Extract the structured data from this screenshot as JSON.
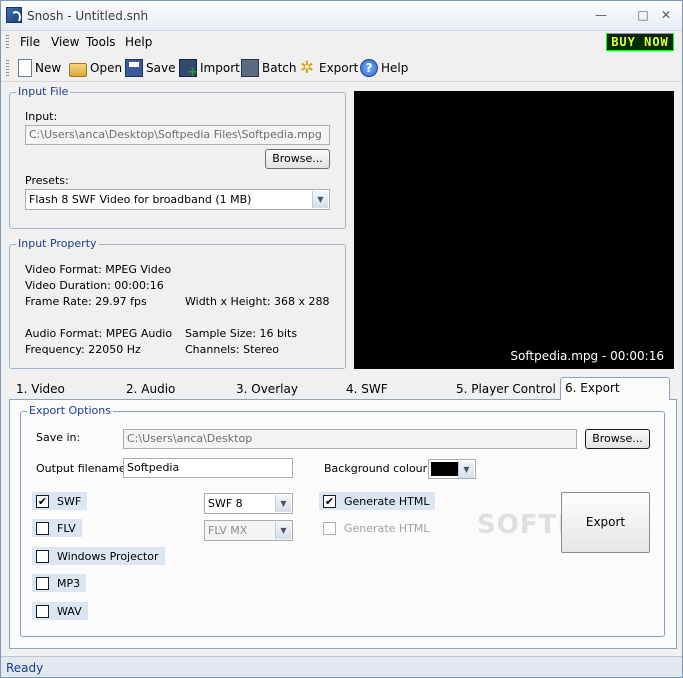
{
  "window": {
    "title": "Snosh - Untitled.snh",
    "minimize": "—",
    "maximize": "□",
    "close": "✕"
  },
  "menu": {
    "items": [
      "File",
      "View",
      "Tools",
      "Help"
    ],
    "buy_now": "BUY NOW"
  },
  "toolbar": {
    "new": "New",
    "open": "Open",
    "save": "Save",
    "import": "Import",
    "batch": "Batch",
    "export": "Export",
    "help": "Help"
  },
  "input_file": {
    "group_label": "Input File",
    "input_label": "Input:",
    "input_value": "C:\\Users\\anca\\Desktop\\Softpedia Files\\Softpedia.mpg",
    "browse": "Browse...",
    "presets_label": "Presets:",
    "preset_value": "Flash 8 SWF Video for broadband (1 MB)"
  },
  "input_property": {
    "group_label": "Input Property",
    "video_format": "Video Format: MPEG Video",
    "video_duration": "Video Duration: 00:00:16",
    "frame_rate": "Frame Rate: 29.97 fps",
    "dimensions": "Width x Height: 368 x 288",
    "audio_format": "Audio Format: MPEG Audio",
    "sample_size": "Sample Size: 16 bits",
    "frequency": "Frequency: 22050 Hz",
    "channels": "Channels: Stereo"
  },
  "preview": {
    "caption": "Softpedia.mpg - 00:00:16"
  },
  "tabs": [
    "1. Video",
    "2. Audio",
    "3. Overlay",
    "4. SWF",
    "5. Player Control",
    "6. Export"
  ],
  "export_options": {
    "group_label": "Export Options",
    "save_in_label": "Save in:",
    "save_in_value": "C:\\Users\\anca\\Desktop",
    "browse": "Browse...",
    "output_filename_label": "Output filename:",
    "output_filename_value": "Softpedia",
    "background_colour_label": "Background colour:",
    "background_colour": "#000000",
    "swf": "SWF",
    "flv": "FLV",
    "windows_projector": "Windows Projector",
    "mp3": "MP3",
    "wav": "WAV",
    "swf_version": "SWF 8",
    "flv_version": "FLV MX",
    "generate_html_1": "Generate HTML",
    "generate_html_2": "Generate HTML",
    "export_button": "Export",
    "check": "✔"
  },
  "watermark": "SOFTPEDIA",
  "status": {
    "text": "Ready"
  }
}
